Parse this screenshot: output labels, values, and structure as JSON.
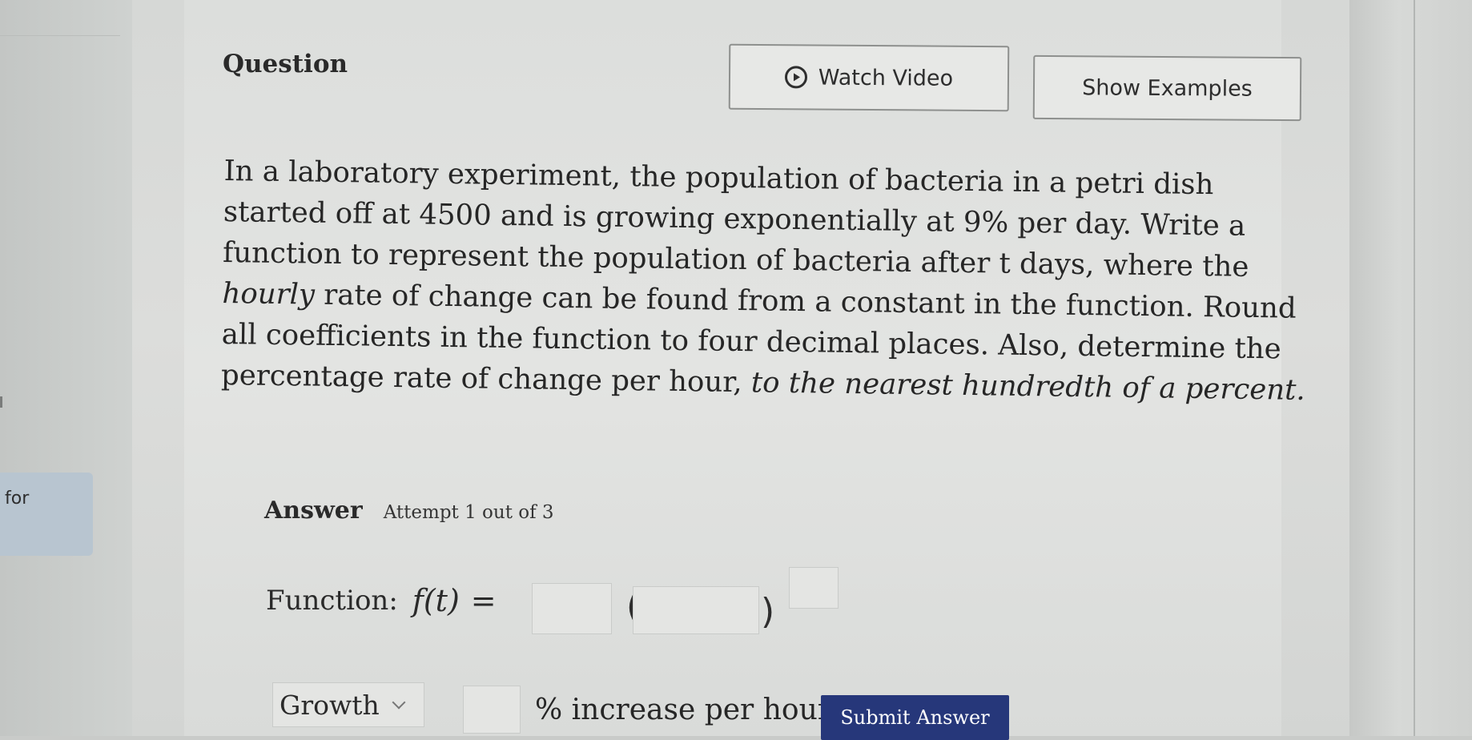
{
  "question": {
    "title": "Question",
    "watch_video_label": "Watch Video",
    "show_examples_label": "Show Examples",
    "lines": [
      "In a laboratory experiment, the population of bacteria in a petri dish",
      "started off at 4500 and is growing exponentially at 9% per day. Write a",
      "function to represent the population of bacteria after t days, where the",
      "rate of change can be found from a constant in the function. Round",
      "all coefficients in the function to four decimal places. Also, determine the",
      "percentage rate of change per hour, "
    ],
    "line4_italic": "hourly",
    "line6_italic": "to the nearest hundredth of a percent."
  },
  "sidebar": {
    "tab_label": "for"
  },
  "answer": {
    "label": "Answer",
    "attempt": "Attempt 1 out of 3",
    "function_label": "Function:",
    "function_expr": "f(t)",
    "equals": "=",
    "growth_select": "Growth",
    "percent_text": "% increase per hour",
    "submit_label": "Submit Answer"
  },
  "colors": {
    "submit": "#26377a",
    "panel": "#e3e4e2"
  },
  "icons": {
    "video": "play-circle-icon",
    "select": "chevron-down-icon"
  }
}
